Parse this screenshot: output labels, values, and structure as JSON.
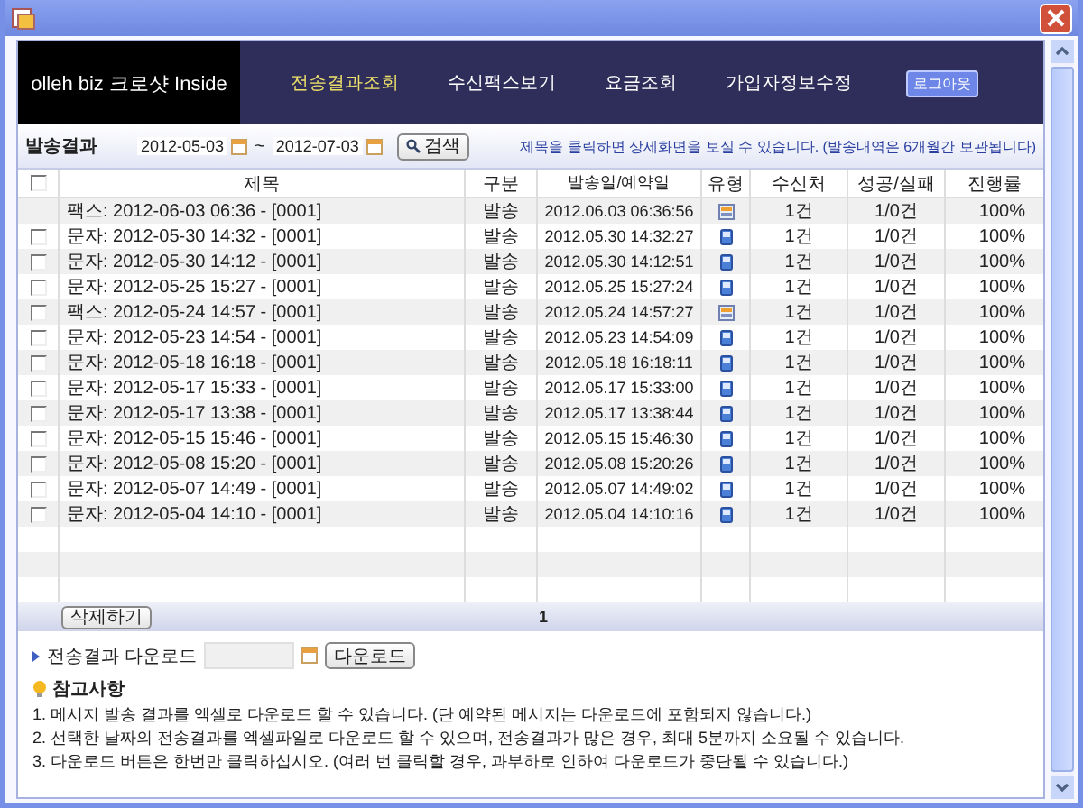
{
  "header": {
    "logo": "olleh biz 크로샷 Inside",
    "nav": [
      {
        "label": "전송결과조회",
        "selected": true
      },
      {
        "label": "수신팩스보기",
        "selected": false
      },
      {
        "label": "요금조회",
        "selected": false
      },
      {
        "label": "가입자정보수정",
        "selected": false
      }
    ],
    "logout": "로그아웃"
  },
  "filter": {
    "label": "발송결과",
    "from": "2012-05-03",
    "sep": "~",
    "to": "2012-07-03",
    "search": "검색",
    "note": "제목을 클릭하면 상세화면을 보실 수 있습니다. (발송내역은 6개월간 보관됩니다)"
  },
  "table": {
    "select_all_checked": false,
    "columns": [
      "제목",
      "구분",
      "발송일/예약일",
      "유형",
      "수신처",
      "성공/실패",
      "진행률"
    ],
    "rows": [
      {
        "title": "팩스: 2012-06-03 06:36 - [0001]",
        "division": "발송",
        "date": "2012.06.03 06:36:56",
        "kind": "fax",
        "recipients": "1건",
        "result": "1/0건",
        "progress": "100%"
      },
      {
        "checked": false,
        "title": "문자: 2012-05-30 14:32 - [0001]",
        "division": "발송",
        "date": "2012.05.30 14:32:27",
        "kind": "sms",
        "recipients": "1건",
        "result": "1/0건",
        "progress": "100%"
      },
      {
        "checked": false,
        "title": "문자: 2012-05-30 14:12 - [0001]",
        "division": "발송",
        "date": "2012.05.30 14:12:51",
        "kind": "sms",
        "recipients": "1건",
        "result": "1/0건",
        "progress": "100%"
      },
      {
        "checked": false,
        "title": "문자: 2012-05-25 15:27 - [0001]",
        "division": "발송",
        "date": "2012.05.25 15:27:24",
        "kind": "sms",
        "recipients": "1건",
        "result": "1/0건",
        "progress": "100%"
      },
      {
        "checked": false,
        "title": "팩스: 2012-05-24 14:57 - [0001]",
        "division": "발송",
        "date": "2012.05.24 14:57:27",
        "kind": "fax",
        "recipients": "1건",
        "result": "1/0건",
        "progress": "100%"
      },
      {
        "checked": false,
        "title": "문자: 2012-05-23 14:54 - [0001]",
        "division": "발송",
        "date": "2012.05.23 14:54:09",
        "kind": "sms",
        "recipients": "1건",
        "result": "1/0건",
        "progress": "100%"
      },
      {
        "checked": false,
        "title": "문자: 2012-05-18 16:18 - [0001]",
        "division": "발송",
        "date": "2012.05.18 16:18:11",
        "kind": "sms",
        "recipients": "1건",
        "result": "1/0건",
        "progress": "100%"
      },
      {
        "checked": false,
        "title": "문자: 2012-05-17 15:33 - [0001]",
        "division": "발송",
        "date": "2012.05.17 15:33:00",
        "kind": "sms",
        "recipients": "1건",
        "result": "1/0건",
        "progress": "100%"
      },
      {
        "checked": false,
        "title": "문자: 2012-05-17 13:38 - [0001]",
        "division": "발송",
        "date": "2012.05.17 13:38:44",
        "kind": "sms",
        "recipients": "1건",
        "result": "1/0건",
        "progress": "100%"
      },
      {
        "checked": false,
        "title": "문자: 2012-05-15 15:46 - [0001]",
        "division": "발송",
        "date": "2012.05.15 15:46:30",
        "kind": "sms",
        "recipients": "1건",
        "result": "1/0건",
        "progress": "100%"
      },
      {
        "checked": false,
        "title": "문자: 2012-05-08 15:20 - [0001]",
        "division": "발송",
        "date": "2012.05.08 15:20:26",
        "kind": "sms",
        "recipients": "1건",
        "result": "1/0건",
        "progress": "100%"
      },
      {
        "checked": false,
        "title": "문자: 2012-05-07 14:49 - [0001]",
        "division": "발송",
        "date": "2012.05.07 14:49:02",
        "kind": "sms",
        "recipients": "1건",
        "result": "1/0건",
        "progress": "100%"
      },
      {
        "checked": false,
        "title": "문자: 2012-05-04 14:10 - [0001]",
        "division": "발송",
        "date": "2012.05.04 14:10:16",
        "kind": "sms",
        "recipients": "1건",
        "result": "1/0건",
        "progress": "100%"
      }
    ]
  },
  "pager": {
    "delete": "삭제하기",
    "page": "1"
  },
  "download": {
    "label": "전송결과 다운로드",
    "button": "다운로드"
  },
  "notes": {
    "title": "참고사항",
    "items": [
      "1. 메시지 발송 결과를 엑셀로 다운로드 할 수 있습니다. (단 예약된 메시지는 다운로드에 포함되지 않습니다.)",
      "2. 선택한 날짜의 전송결과를 엑셀파일로 다운로드 할 수 있으며, 전송결과가 많은 경우, 최대 5분까지 소요될 수 있습니다.",
      "3. 다운로드 버튼은 한번만 클릭하십시오. (여러 번 클릭할 경우, 과부하로 인하여 다운로드가 중단될 수 있습니다.)"
    ]
  }
}
